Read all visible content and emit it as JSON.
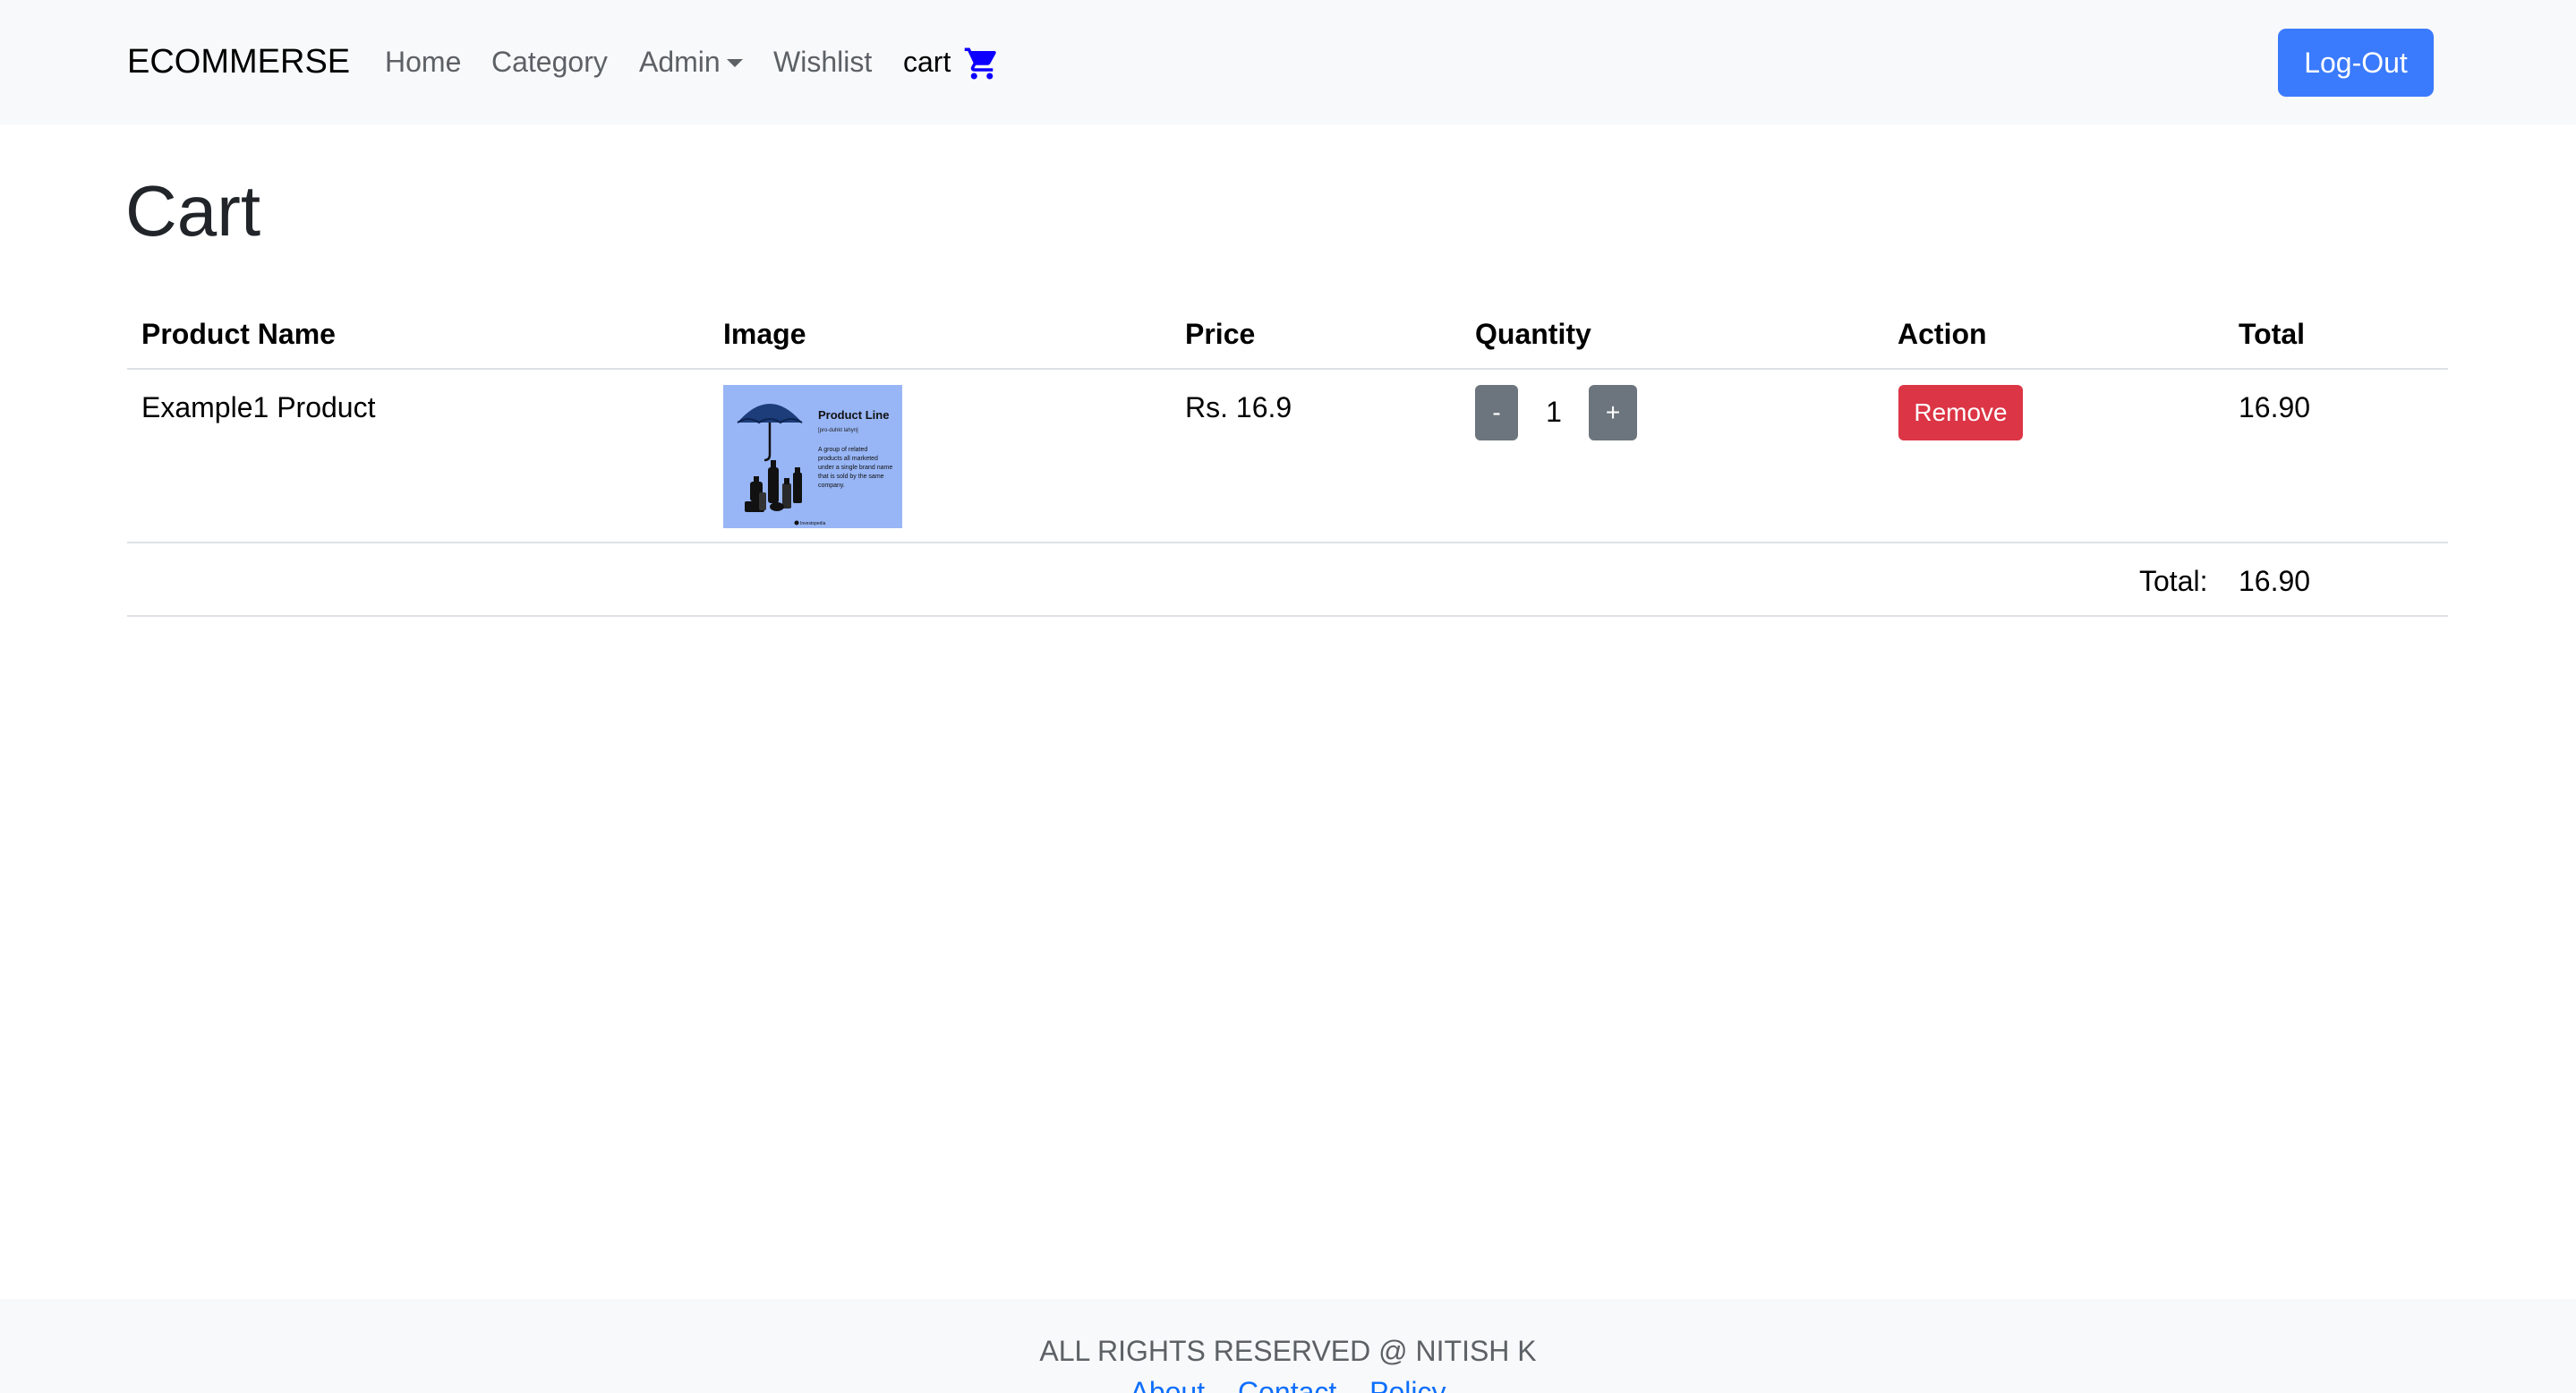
{
  "navbar": {
    "brand": "ECOMMERSE",
    "links": {
      "home": "Home",
      "category": "Category",
      "admin": "Admin",
      "wishlist": "Wishlist",
      "cart": "cart"
    },
    "cart_icon": "shopping-cart-icon",
    "admin_caret_icon": "caret-down-icon",
    "logout_label": "Log-Out"
  },
  "page": {
    "title": "Cart"
  },
  "table": {
    "headers": [
      "Product Name",
      "Image",
      "Price",
      "Quantity",
      "Action",
      "Total"
    ],
    "rows": [
      {
        "name": "Example1 Product",
        "image": {
          "title": "Product Line",
          "subtitle": "[pro-duhkt lahyn]",
          "description": "A group of related products all marketed under a single brand name that is sold by the same company.",
          "credit": "Investopedia"
        },
        "price": "Rs. 16.9",
        "quantity": "1",
        "minus_label": "-",
        "plus_label": "+",
        "action_label": "Remove",
        "total": "16.90"
      }
    ],
    "footer": {
      "label": "Total:",
      "value": "16.90"
    }
  },
  "footer": {
    "text": "ALL RIGHTS RESERVED @ NITISH K",
    "links": [
      "About",
      "Contact",
      "Policy"
    ]
  },
  "colors": {
    "navbar_bg": "#f8f9fa",
    "primary": "#3a7afd",
    "secondary": "#6c757d",
    "danger": "#dc3545",
    "cart_icon": "#0d00ff",
    "product_image_bg": "#98b6f6"
  }
}
